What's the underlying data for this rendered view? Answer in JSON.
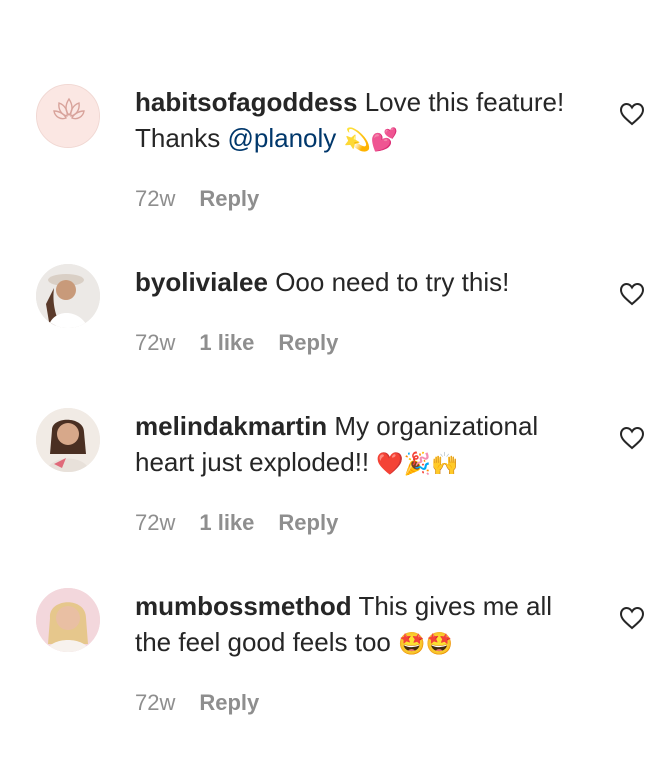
{
  "comments": [
    {
      "username": "habitsofagoddess",
      "text": "Love this feature! Thanks ",
      "mention": "@planoly",
      "emoji": "💫💕",
      "time": "72w",
      "likes": "",
      "reply": "Reply",
      "avatar": "lotus-logo-avatar",
      "avatar_caption": "HABITSOFAGODDESS"
    },
    {
      "username": "byolivialee",
      "text": "Ooo need to try this!",
      "mention": "",
      "emoji": "",
      "time": "72w",
      "likes": "1 like",
      "reply": "Reply",
      "avatar": "woman-with-hat-avatar"
    },
    {
      "username": "melindakmartin",
      "text": "My organizational heart just exploded!! ",
      "mention": "",
      "emoji": "❤️🎉🙌",
      "time": "72w",
      "likes": "1 like",
      "reply": "Reply",
      "avatar": "woman-smiling-avatar"
    },
    {
      "username": "mumbossmethod",
      "text": "This gives me all the feel good feels too ",
      "mention": "",
      "emoji": "🤩🤩",
      "time": "72w",
      "likes": "",
      "reply": "Reply",
      "avatar": "blonde-woman-avatar"
    }
  ],
  "colors": {
    "text": "#262626",
    "meta": "#8e8e8e",
    "mention": "#00376b"
  }
}
